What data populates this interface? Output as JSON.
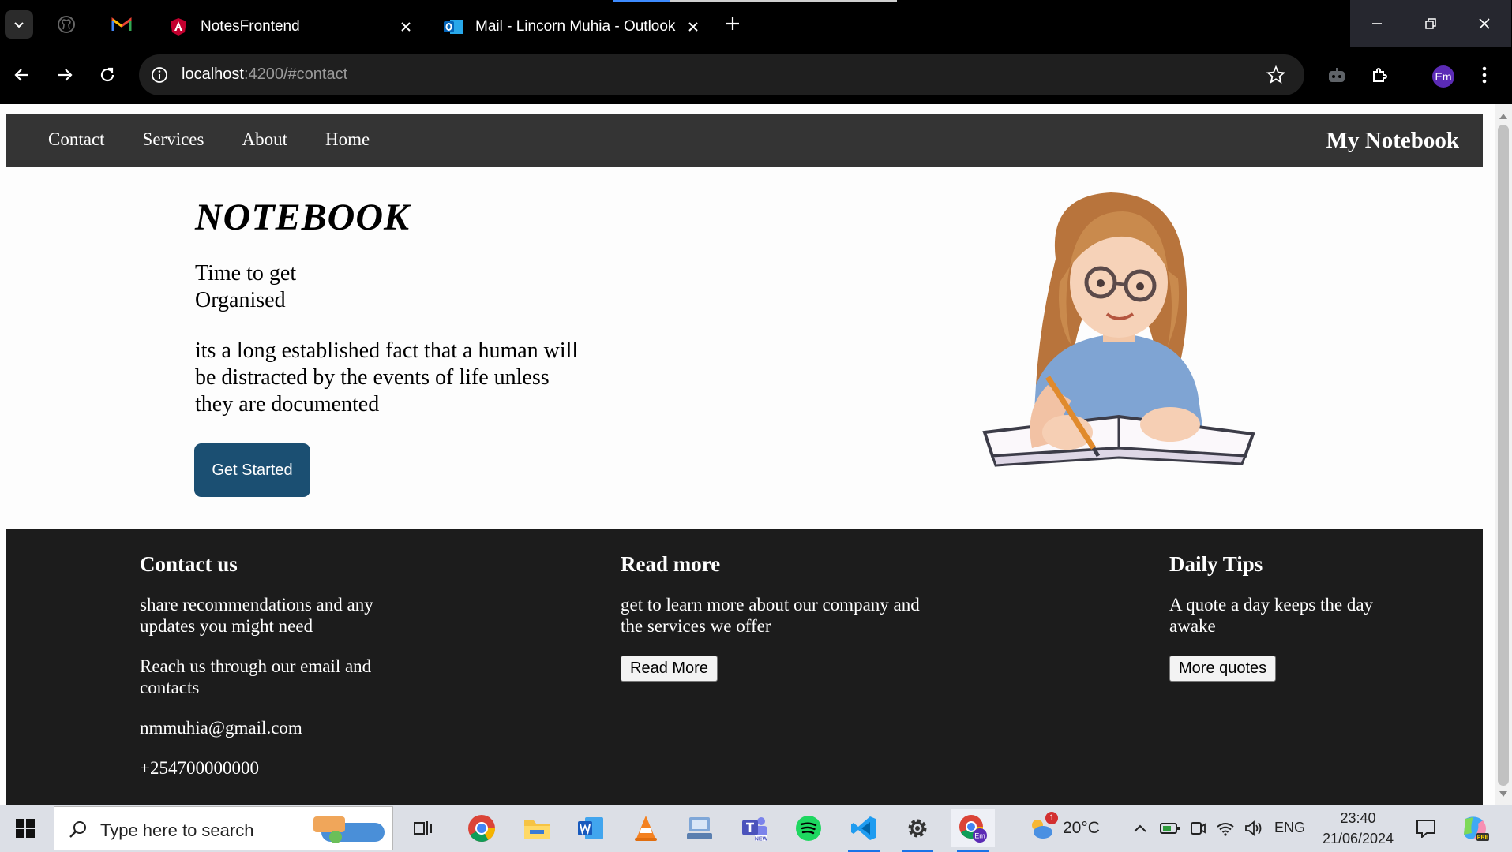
{
  "browser": {
    "tabs": [
      {
        "title": "NotesFrontend",
        "favicon": "angular-icon",
        "active": true
      },
      {
        "title": "Mail - Lincorn Muhia - Outlook",
        "favicon": "outlook-icon",
        "active": false
      }
    ],
    "pinned_tabs": [
      "github-icon",
      "gmail-icon"
    ],
    "url_host": "localhost",
    "url_path": ":4200/#contact",
    "profile_initials": "Em"
  },
  "site": {
    "nav_links": [
      "Contact",
      "Services",
      "About",
      "Home"
    ],
    "brand": "My Notebook",
    "hero": {
      "title": "NOTEBOOK",
      "tagline": "Time to get Organised",
      "lead": "its a long established fact that a human will be distracted by the events of life unless they are documented",
      "cta": "Get Started",
      "image_alt": "girl-writing-in-notebook-illustration"
    },
    "footer": {
      "contact": {
        "heading": "Contact us",
        "p1": "share recommendations and any updates you might need",
        "p2": "Reach us through our email and contacts",
        "email": "nmmuhia@gmail.com",
        "phone": "+254700000000"
      },
      "read_more": {
        "heading": "Read more",
        "text": "get to learn more about our company and the services we offer",
        "button": "Read More"
      },
      "tips": {
        "heading": "Daily Tips",
        "text": "A quote a day keeps the day awake",
        "button": "More quotes"
      }
    }
  },
  "taskbar": {
    "search_placeholder": "Type here to search",
    "apps": [
      "task-view-icon",
      "chrome-icon",
      "file-explorer-icon",
      "word-icon",
      "vlc-icon",
      "network-app-icon",
      "teams-icon",
      "spotify-icon",
      "vscode-icon",
      "settings-icon",
      "chrome-profile-icon"
    ],
    "weather": {
      "temp": "20°C",
      "badge": "1"
    },
    "lang": "ENG",
    "time": "23:40",
    "date": "21/06/2024"
  }
}
